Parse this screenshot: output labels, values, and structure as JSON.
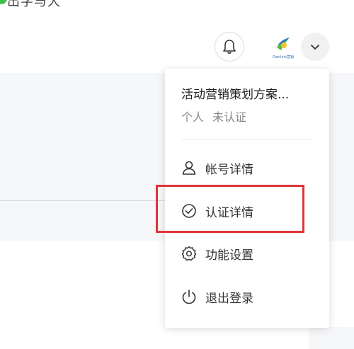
{
  "header_strip": {
    "title": "出字与大"
  },
  "header": {
    "avatar_caption": "Ownlink营销"
  },
  "dropdown": {
    "profile_name": "活动营销策划方案...",
    "profile_type": "个人",
    "verify_status": "未认证",
    "items": [
      {
        "label": "帐号详情",
        "icon": "user-icon"
      },
      {
        "label": "认证详情",
        "icon": "check-circle-icon"
      },
      {
        "label": "功能设置",
        "icon": "gear-icon"
      },
      {
        "label": "退出登录",
        "icon": "power-icon"
      }
    ]
  },
  "colors": {
    "highlight": "#e0343a",
    "status_dot": "#3fbf4a",
    "avatar_brand": "#3a6fb0"
  }
}
